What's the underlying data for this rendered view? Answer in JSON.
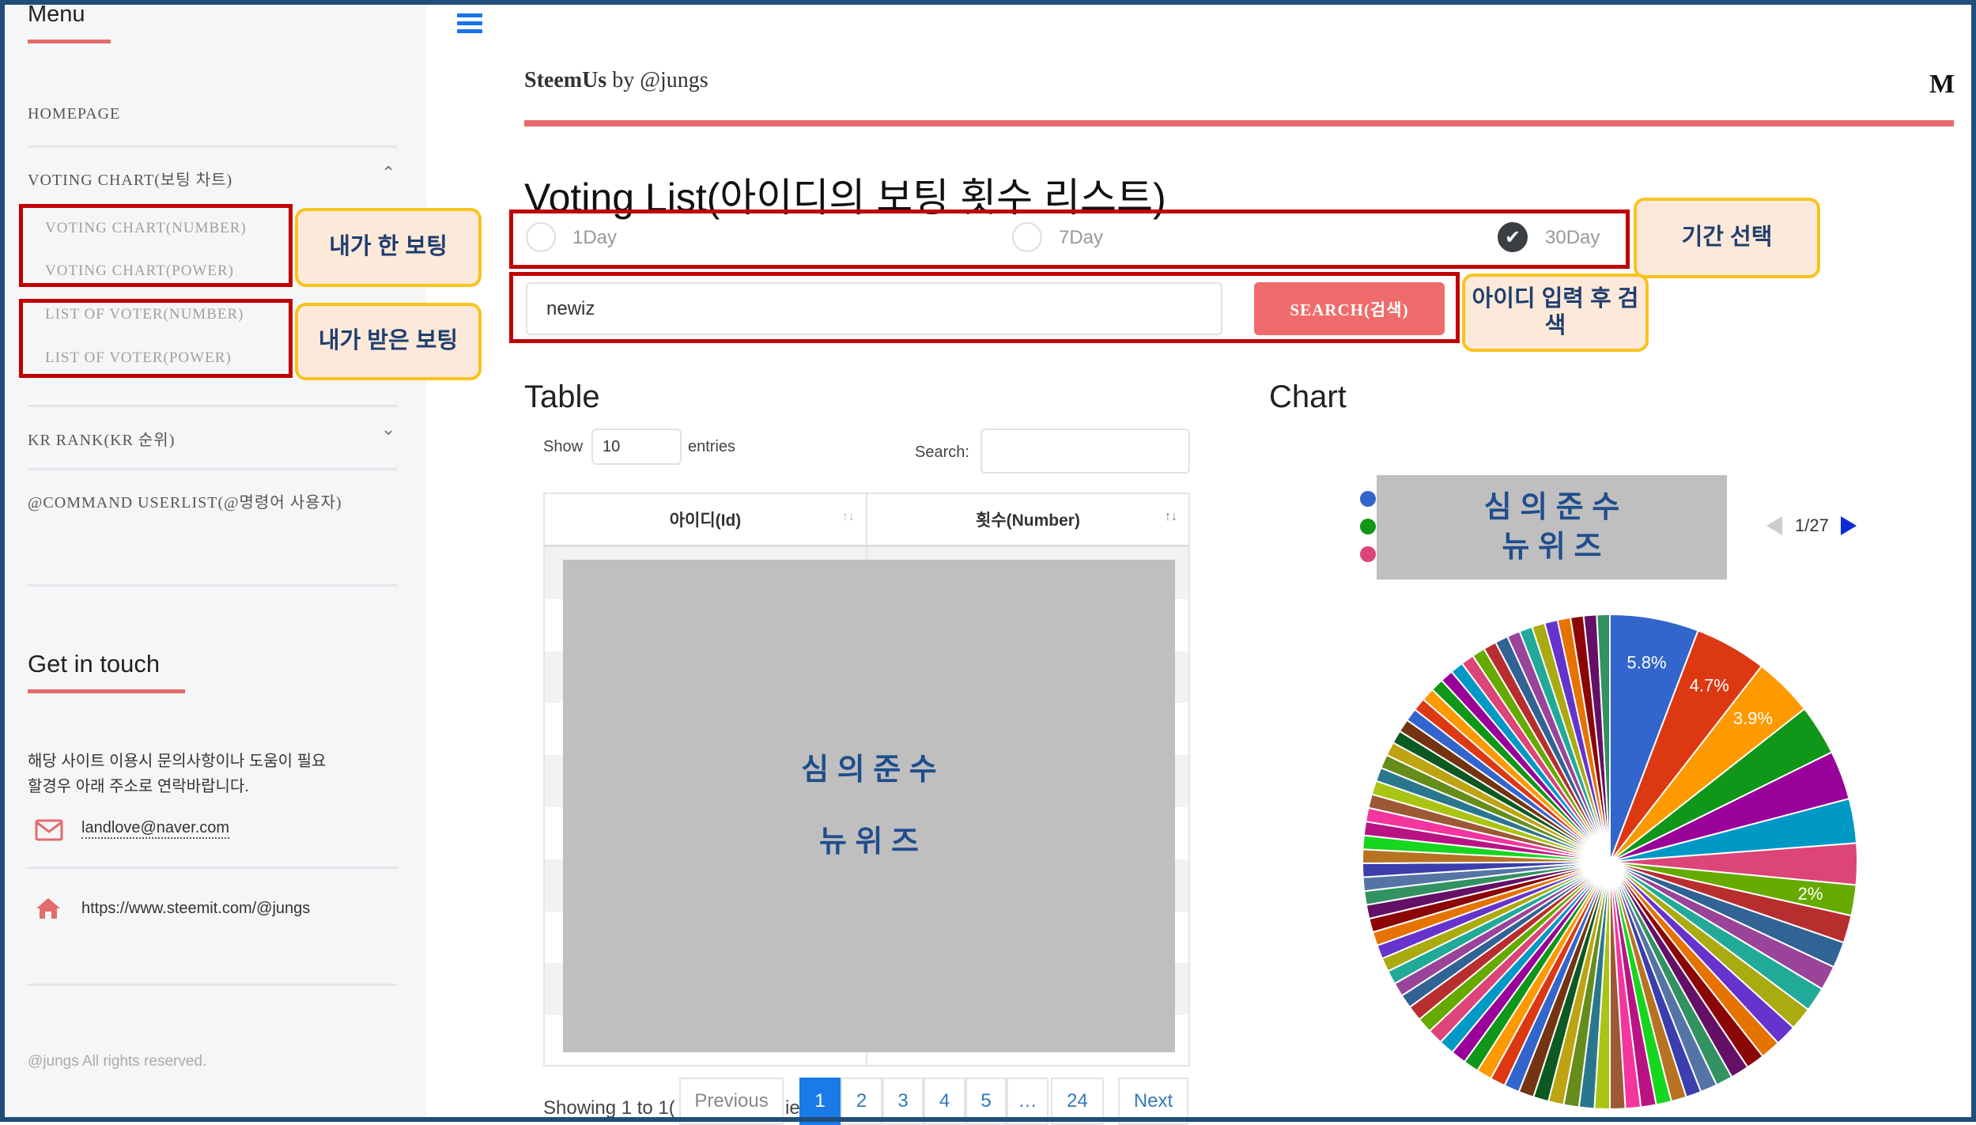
{
  "sidebar": {
    "menu_title": "Menu",
    "items": [
      {
        "label": "HOMEPAGE"
      },
      {
        "label": "VOTING CHART(보팅 차트)",
        "sub": [
          "VOTING CHART(NUMBER)",
          "VOTING CHART(POWER)",
          "LIST OF VOTER(NUMBER)",
          "LIST OF VOTER(POWER)"
        ]
      },
      {
        "label": "KR RANK(KR 순위)"
      },
      {
        "label": "@COMMAND USERLIST(@명령어 사용자)"
      }
    ],
    "contact_title": "Get in touch",
    "contact_text_1": "해당 사이트 이용시 문의사항이나 도움이 필요",
    "contact_text_2": "할경우 아래 주소로 연락바랍니다.",
    "email": "landlove@naver.com",
    "url": "https://www.steemit.com/@jungs",
    "footer": "@jungs All rights reserved."
  },
  "annotations": {
    "my_votes": "내가 한 보팅",
    "received_votes": "내가 받은 보팅",
    "period": "기간 선택",
    "search_hint": "아이디 입력 후 검색",
    "mask_text": "심 의 준 수 뉴 위 즈",
    "mask_line_1": "심 의 준 수",
    "mask_line_2": "뉴 위 즈"
  },
  "header": {
    "brand": "SteemUs",
    "by": " by @jungs",
    "logo": "M"
  },
  "main": {
    "title": "Voting List(아이디의 보팅 횟수 리스트)",
    "periods": [
      {
        "label": "1Day",
        "checked": false
      },
      {
        "label": "7Day",
        "checked": false
      },
      {
        "label": "30Day",
        "checked": true
      }
    ],
    "search_value": "newiz",
    "search_button": "SEARCH(검색)",
    "table_heading": "Table",
    "chart_heading": "Chart",
    "show_label": "Show",
    "entries_value": "10",
    "entries_label": "entries",
    "search_label": "Search:",
    "columns": [
      "아이디(Id)",
      "횟수(Number)"
    ],
    "showing_text": "Showing 1 to 1(",
    "showing_tail": "ie",
    "pagination": {
      "previous": "Previous",
      "pages": [
        "1",
        "2",
        "3",
        "4",
        "5",
        "…",
        "24"
      ],
      "active": "1",
      "next": "Next"
    },
    "legend_pager": "1/27"
  },
  "colors": {
    "accent": "#e86a6a",
    "button": "#f06b6b",
    "link": "#337ab7",
    "active_page": "#1a7ae8",
    "annotation_box": "#c00000",
    "callout_border": "#f8c31c"
  },
  "chart_data": {
    "type": "pie",
    "legend_placement": "top",
    "legend_colors": [
      "#3366cc",
      "#109618",
      "#dd4477"
    ],
    "slice_labels": [
      "5.8%",
      "4.7%",
      "3.9%",
      "",
      "",
      "",
      "",
      "2%"
    ],
    "values": [
      5.8,
      4.7,
      3.9,
      3.3,
      3.2,
      2.9,
      2.7,
      2.0,
      1.8,
      1.7,
      1.6,
      1.6,
      1.5,
      1.4,
      1.3,
      1.2,
      1.2,
      1.1,
      1.1,
      1.0,
      1.0,
      1.0,
      1.0,
      1.0,
      1.0,
      1.0,
      1.0,
      1.0,
      1.0,
      1.0,
      1.0,
      1.0,
      1.0,
      1.0,
      1.0,
      1.0,
      1.0,
      1.0,
      1.0,
      1.0,
      0.9,
      0.9,
      0.9,
      0.9,
      0.9,
      0.9,
      0.9,
      0.9,
      0.9,
      0.9,
      0.9,
      0.9,
      0.9,
      0.9,
      0.9,
      0.9,
      0.9,
      0.9,
      0.9,
      0.9,
      0.85,
      0.85,
      0.85,
      0.85,
      0.85,
      0.85,
      0.85,
      0.85,
      0.85,
      0.85,
      0.85,
      0.85,
      0.85,
      0.85,
      0.85,
      0.85,
      0.85,
      0.85,
      0.85,
      0.85
    ],
    "palette": [
      "#3366cc",
      "#dc3912",
      "#ff9900",
      "#109618",
      "#990099",
      "#0099c6",
      "#dd4477",
      "#66aa00",
      "#b82e2e",
      "#316395",
      "#994499",
      "#22aa99",
      "#aaaa11",
      "#6633cc",
      "#e67300",
      "#8b0707",
      "#651067",
      "#329262",
      "#5574a6",
      "#3b3eac",
      "#b77322",
      "#16d620",
      "#b91383",
      "#f4359e",
      "#9c5935",
      "#a9c413",
      "#2a778d",
      "#668d1c",
      "#bea413",
      "#0c5922",
      "#743411"
    ]
  }
}
